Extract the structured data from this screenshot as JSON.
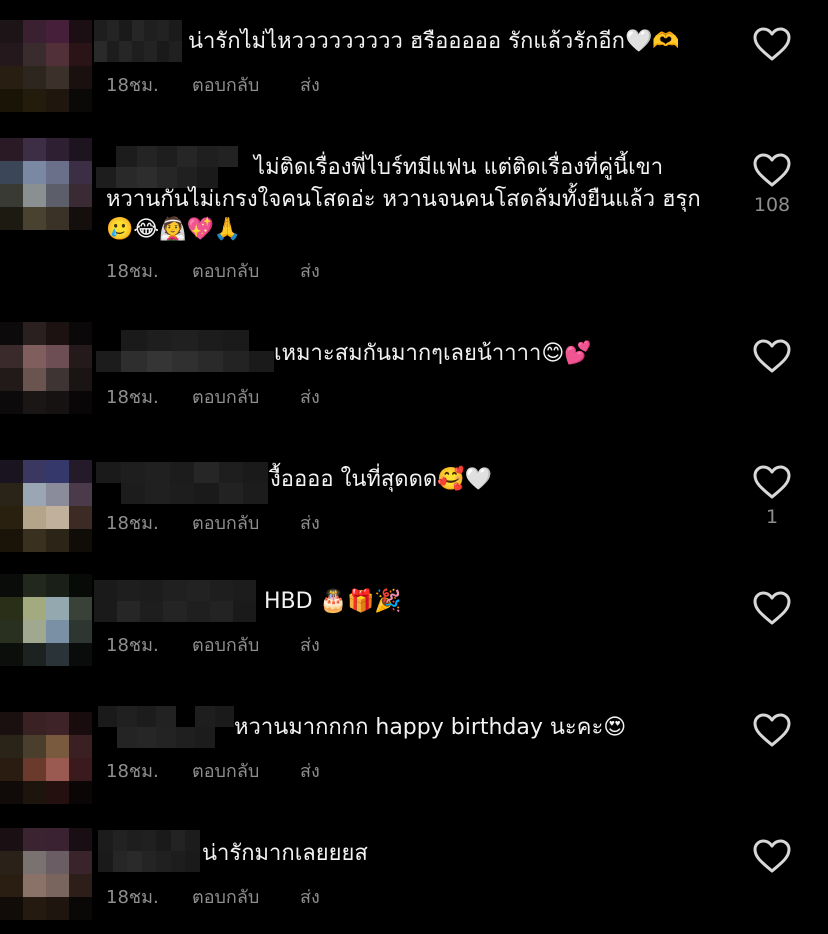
{
  "comments": [
    {
      "text": "น่ารักไม่ไหววววววววว ฮรือออออ รักแล้วรักอีก🤍🫶",
      "time": "18ชม.",
      "reply": "ตอบกลับ",
      "send": "ส่ง",
      "likes": ""
    },
    {
      "text": "ไม่ติดเรื่องพี่ไบร์ทมีแฟน แต่ติดเรื่องที่คู่นี้เขา",
      "text2": "หวานกันไม่เกรงใจคนโสดอ่ะ หวานจนคนโสดล้มทั้งยืนแล้ว ฮรุก",
      "text3": "🥲😂👰💖🙏",
      "time": "18ชม.",
      "reply": "ตอบกลับ",
      "send": "ส่ง",
      "likes": "108"
    },
    {
      "text": "เหมาะสมกันมากๆเลยน้าาาา😊💕",
      "time": "18ชม.",
      "reply": "ตอบกลับ",
      "send": "ส่ง",
      "likes": ""
    },
    {
      "text": "งื้ออออ ในที่สุดดด🥰🤍",
      "time": "18ชม.",
      "reply": "ตอบกลับ",
      "send": "ส่ง",
      "likes": "1"
    },
    {
      "text": "HBD 🎂🎁🎉",
      "time": "18ชม.",
      "reply": "ตอบกลับ",
      "send": "ส่ง",
      "likes": ""
    },
    {
      "text": "หวานมากกกก happy birthday นะคะ😍",
      "time": "18ชม.",
      "reply": "ตอบกลับ",
      "send": "ส่ง",
      "likes": ""
    },
    {
      "text": "น่ารักมากเลยยยส",
      "time": "18ชม.",
      "reply": "ตอบกลับ",
      "send": "ส่ง",
      "likes": ""
    }
  ],
  "icons": {
    "like": "heart-outline-icon"
  },
  "colors": {
    "background": "#000000",
    "text": "#f2f2f2",
    "meta": "#8e8e8e",
    "icon": "#d8d8d8"
  }
}
